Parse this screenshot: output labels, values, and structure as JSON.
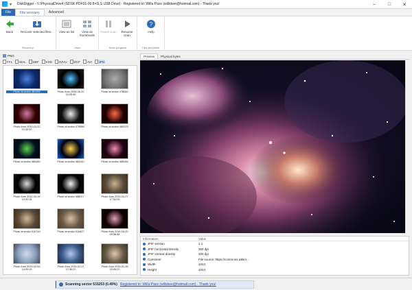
{
  "window": {
    "title": "DiskDigger - \\\\.\\PhysicalDrive4 (SDSK PDF01-00 8×G,S USB Drive) - Registered to: Willa Pace (willsbee@hotmail.com) - Thank you!",
    "min_glyph": "–",
    "max_glyph": "□",
    "close_glyph": "✕",
    "quick_access": "▾"
  },
  "tabs": {
    "file": "File",
    "file_recovery": "File recovery",
    "advanced": "Advanced"
  },
  "ribbon": {
    "buttons": [
      {
        "label": "Back",
        "icon": "back-arrow-icon",
        "enabled": true
      },
      {
        "label": "Recover selected files...",
        "icon": "recover-icon",
        "enabled": true
      },
      {
        "label": "View as list",
        "icon": "list-view-icon",
        "enabled": true
      },
      {
        "label": "View as thumbnails",
        "icon": "thumbnails-view-icon",
        "enabled": true
      },
      {
        "label": "Pause scan",
        "icon": "pause-icon",
        "enabled": false
      },
      {
        "label": "Resume scan",
        "icon": "play-icon",
        "enabled": true
      },
      {
        "label": "Help",
        "icon": "help-icon",
        "enabled": true
      }
    ],
    "groups": [
      "Recovery",
      "View",
      "Scan progress",
      "Tips and tricks"
    ]
  },
  "path": {
    "label": "PNG"
  },
  "file_types": [
    "FF1",
    "WAL",
    "DBF",
    "KSD",
    "DJVU",
    "DCF",
    "AVI",
    "JPG"
  ],
  "thumbnails": [
    {
      "caption": "Photo at sector 481934",
      "selected": true,
      "colors": [
        "#0b2a6e",
        "#4d7fd6",
        "#0a1a3e"
      ]
    },
    {
      "caption": "Photo from 2005-05-20\n19:35:30",
      "colors": [
        "#000",
        "#4fc3ff",
        "#222"
      ]
    },
    {
      "caption": "Photo at sector 478640",
      "colors": [
        "#777",
        "#aaa",
        "#444"
      ]
    },
    {
      "caption": "Photo from 2010-10-22\n12:39:20",
      "colors": [
        "#300",
        "#d07aa0",
        "#100"
      ]
    },
    {
      "caption": "Photo at sector 479888",
      "colors": [
        "#111",
        "#eee",
        "#000"
      ]
    },
    {
      "caption": "Photo at sector 480178",
      "colors": [
        "#200",
        "#ff6a4a",
        "#100"
      ]
    },
    {
      "caption": "Photo at sector 480480",
      "colors": [
        "#012",
        "#5fd14a",
        "#000"
      ]
    },
    {
      "caption": "Photo at sector 484240",
      "colors": [
        "#001",
        "#ffd050",
        "#1a5fd0"
      ]
    },
    {
      "caption": "Photo at sector 485084",
      "colors": [
        "#201",
        "#f08ab0",
        "#100"
      ]
    },
    {
      "caption": "Photo from 2012-03-19\n13:32:15",
      "colors": [
        "#000",
        "#ddd",
        "#111"
      ]
    },
    {
      "caption": "Photo at sector 488017",
      "colors": [
        "#000",
        "#f0f0f0",
        "#111"
      ]
    },
    {
      "caption": "Photo from 2019-04-27\n17:52:25",
      "colors": [
        "#5a4a3a",
        "#c8b08a",
        "#3a2a1a"
      ]
    },
    {
      "caption": "Photo at sector 510744",
      "colors": [
        "#5a4a3a",
        "#d0b890",
        "#3a2a1a"
      ]
    },
    {
      "caption": "Photo at sector 510627",
      "colors": [
        "#6a5a4a",
        "#d8c0a0",
        "#4a3a2a"
      ]
    },
    {
      "caption": "Photo from 2019-04-20\n09:56:58",
      "colors": [
        "#100",
        "#e0a0c0",
        "#000"
      ]
    },
    {
      "caption": "Photo from 2019-02-03\n14:05:15",
      "colors": [
        "#8aa0c0",
        "#d0dcea",
        "#445"
      ]
    },
    {
      "caption": "Photo from 2019-02-21\n17:36:22",
      "colors": [
        "#3a5a8a",
        "#b0c8e8",
        "#223"
      ]
    },
    {
      "caption": "Photo from 2019-01-28\n15:06:22",
      "colors": [
        "#6a5a4a",
        "#e0c8a8",
        "#332"
      ]
    }
  ],
  "preview_tabs": [
    "Preview",
    "Physical bytes"
  ],
  "info": {
    "headers": [
      "Information",
      "Value"
    ],
    "rows": [
      {
        "k": "JFIF version",
        "v": "1.1"
      },
      {
        "k": "JFIF horizontal density",
        "v": "300 dpi"
      },
      {
        "k": "JFIF vertical density",
        "v": "300 dpi"
      },
      {
        "k": "Comment",
        "v": "File source: https://commons.wikim..."
      },
      {
        "k": "Width",
        "v": "1024"
      },
      {
        "k": "Height",
        "v": "1024"
      }
    ]
  },
  "status": {
    "scanning": "Scanning sector 531253 (0.49%)",
    "progress": 0.0049,
    "registered": "Registered to: Willa Pace (willsbee@hotmail.com) - Thank you!"
  }
}
